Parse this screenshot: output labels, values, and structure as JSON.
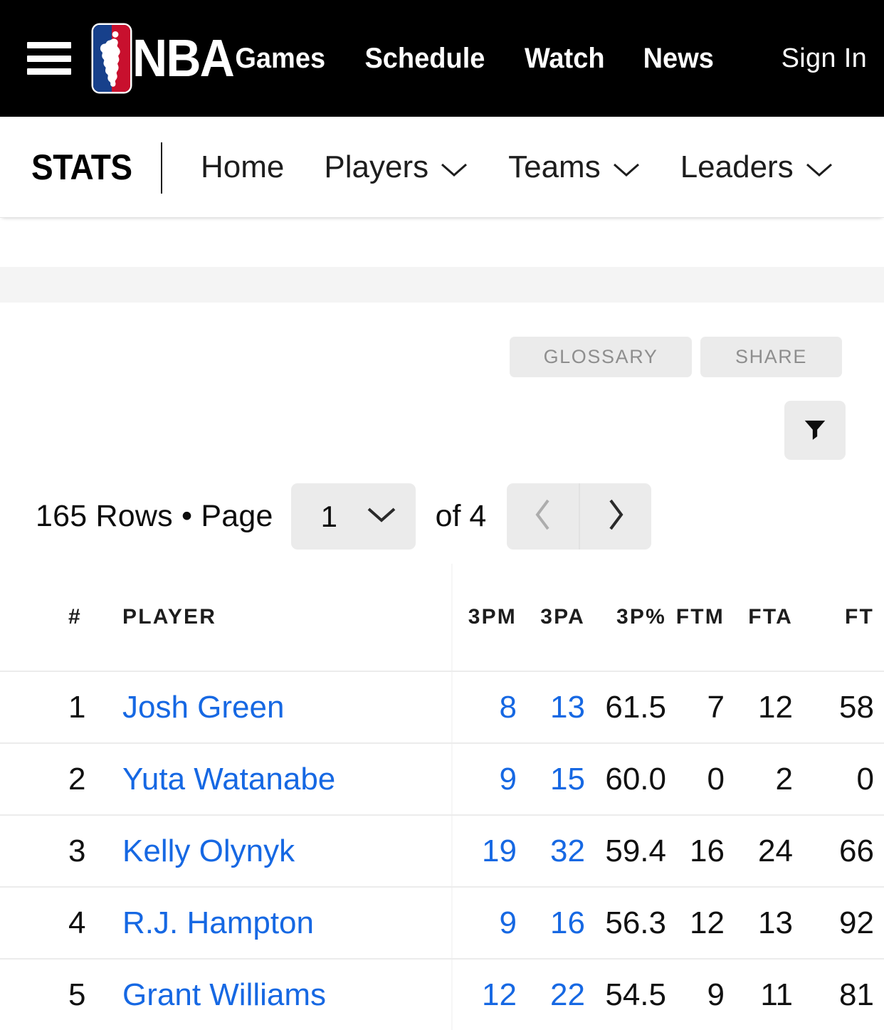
{
  "global_nav": {
    "menu_icon": "hamburger-icon",
    "logo_text": "NBA",
    "links": [
      "Games",
      "Schedule",
      "Watch",
      "News"
    ],
    "sign_in_label": "Sign In"
  },
  "stats_nav": {
    "wordmark": "STATS",
    "items": [
      {
        "label": "Home",
        "has_caret": false
      },
      {
        "label": "Players",
        "has_caret": true
      },
      {
        "label": "Teams",
        "has_caret": true
      },
      {
        "label": "Leaders",
        "has_caret": true
      }
    ]
  },
  "toolbar": {
    "glossary_label": "GLOSSARY",
    "share_label": "SHARE",
    "filter_icon": "filter-funnel-icon"
  },
  "pagination": {
    "rows_label": "165 Rows • Page",
    "page_value": "1",
    "of_label": "of 4",
    "prev_icon": "chevron-left-icon",
    "next_icon": "chevron-right-icon",
    "dropdown_icon": "chevron-down-icon"
  },
  "table": {
    "headers": {
      "rank": "#",
      "player": "PLAYER",
      "stats": [
        "3PM",
        "3PA",
        "3P%",
        "FTM",
        "FTA",
        "FT"
      ]
    },
    "rows": [
      {
        "rank": "1",
        "player": "Josh Green",
        "3pm": "8",
        "3pa": "13",
        "3pp": "61.5",
        "ftm": "7",
        "fta": "12",
        "ftp": "58"
      },
      {
        "rank": "2",
        "player": "Yuta Watanabe",
        "3pm": "9",
        "3pa": "15",
        "3pp": "60.0",
        "ftm": "0",
        "fta": "2",
        "ftp": "0"
      },
      {
        "rank": "3",
        "player": "Kelly Olynyk",
        "3pm": "19",
        "3pa": "32",
        "3pp": "59.4",
        "ftm": "16",
        "fta": "24",
        "ftp": "66"
      },
      {
        "rank": "4",
        "player": "R.J. Hampton",
        "3pm": "9",
        "3pa": "16",
        "3pp": "56.3",
        "ftm": "12",
        "fta": "13",
        "ftp": "92"
      },
      {
        "rank": "5",
        "player": "Grant Williams",
        "3pm": "12",
        "3pa": "22",
        "3pp": "54.5",
        "ftm": "9",
        "fta": "11",
        "ftp": "81"
      }
    ]
  },
  "colors": {
    "link_blue": "#1668e3",
    "nav_black": "#000000",
    "button_grey": "#ebebeb",
    "band_grey": "#f4f4f4",
    "logo_blue": "#17408b",
    "logo_red": "#c8102e"
  }
}
